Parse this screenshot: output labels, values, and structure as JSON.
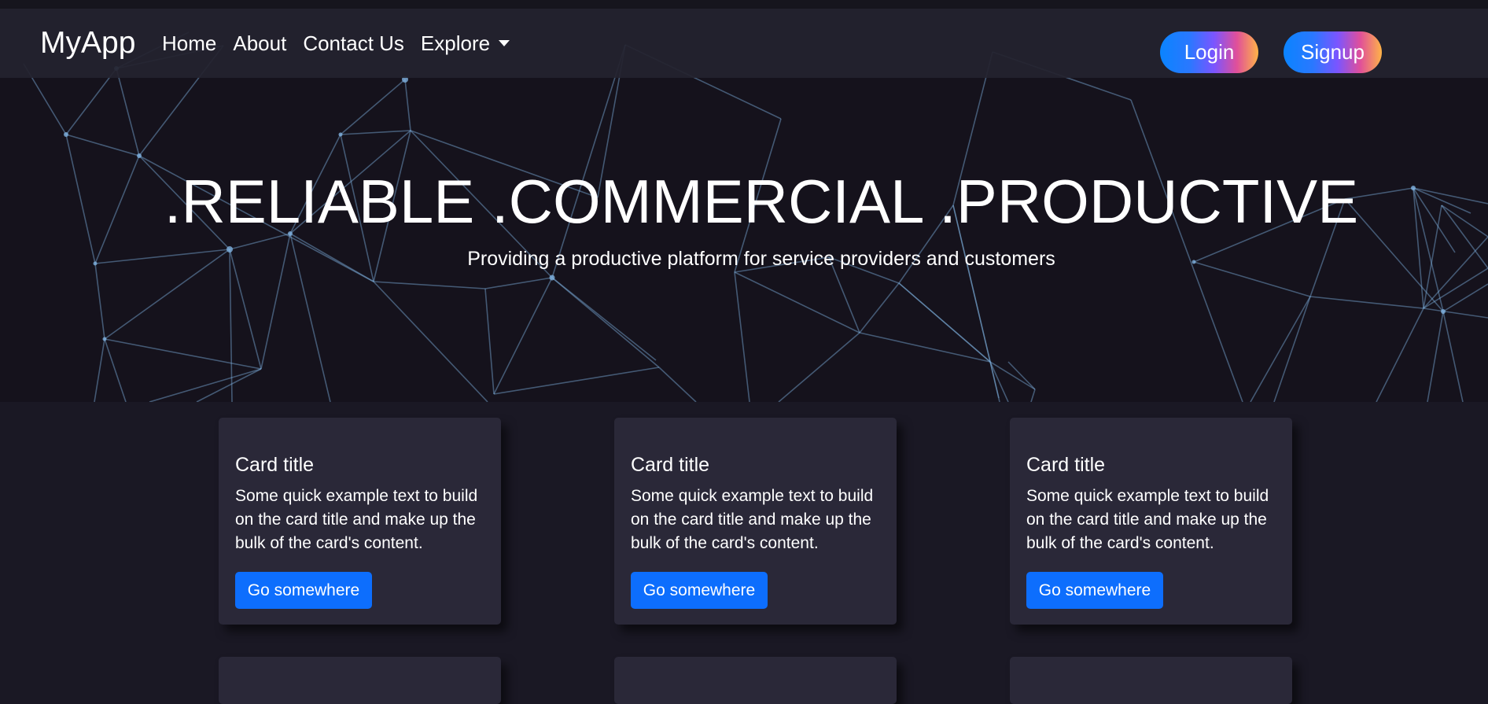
{
  "navbar": {
    "brand": "MyApp",
    "links": [
      "Home",
      "About",
      "Contact Us"
    ],
    "dropdown_label": "Explore",
    "login_label": "Login",
    "signup_label": "Signup"
  },
  "hero": {
    "title": ".RELIABLE .COMMERCIAL .PRODUCTIVE",
    "subtitle": "Providing a productive platform for service providers and customers"
  },
  "cards": [
    {
      "title": "Card title",
      "text": "Some quick example text to build on the card title and make up the bulk of the card's content.",
      "button": "Go somewhere"
    },
    {
      "title": "Card title",
      "text": "Some quick example text to build on the card title and make up the bulk of the card's content.",
      "button": "Go somewhere"
    },
    {
      "title": "Card title",
      "text": "Some quick example text to build on the card title and make up the bulk of the card's content.",
      "button": "Go somewhere"
    }
  ],
  "colors": {
    "background": "#1a1824",
    "hero_background": "#15121c",
    "card_background": "#2a2838",
    "primary_button": "#0d6efd",
    "network_line": "#7fb2e0"
  }
}
